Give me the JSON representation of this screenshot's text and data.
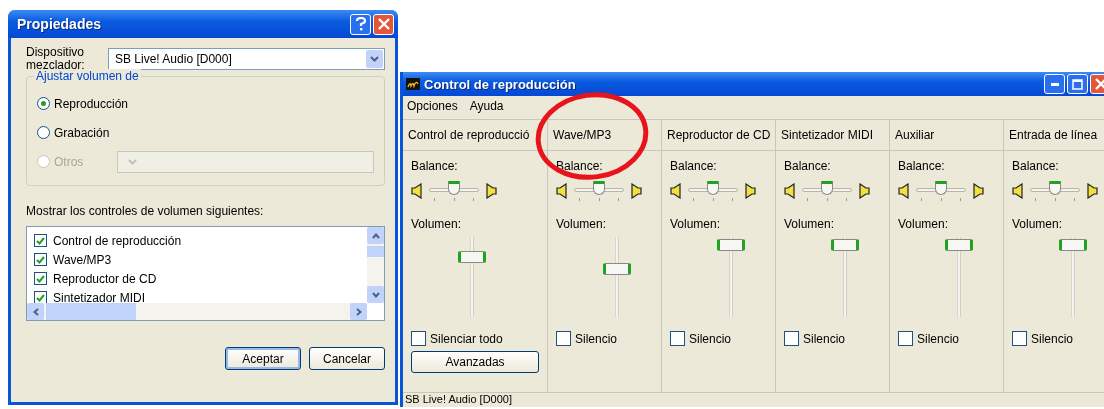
{
  "properties_dialog": {
    "title": "Propiedades",
    "mixer_label": "Dispositivo mezclador:",
    "mixer_value": "SB Live! Audio [D000]",
    "group_title": "Ajustar volumen de",
    "radios": [
      {
        "label": "Reproducción",
        "selected": true,
        "disabled": false
      },
      {
        "label": "Grabación",
        "selected": false,
        "disabled": false
      },
      {
        "label": "Otros",
        "selected": false,
        "disabled": true
      }
    ],
    "others_select": {
      "disabled": true
    },
    "list_label": "Mostrar los controles de volumen siguientes:",
    "list_items": [
      {
        "label": "Control de reproducción",
        "checked": true
      },
      {
        "label": "Wave/MP3",
        "checked": true
      },
      {
        "label": "Reproductor de CD",
        "checked": true
      },
      {
        "label": "Sintetizador MIDI",
        "checked": true
      }
    ],
    "buttons": [
      {
        "label": "Aceptar",
        "default": true
      },
      {
        "label": "Cancelar",
        "default": false
      }
    ]
  },
  "mixer_window": {
    "title": "Control de reproducción",
    "menu": [
      "Opciones",
      "Ayuda"
    ],
    "channels": [
      {
        "name": "Control de reproducció",
        "balance_label": "Balance:",
        "balance": {
          "level": 0.5
        },
        "volume_label": "Volumen:",
        "volume": {
          "level": 0.78
        },
        "mute_label": "Silenciar todo",
        "muted": false,
        "advanced": "Avanzadas"
      },
      {
        "name": "Wave/MP3",
        "balance_label": "Balance:",
        "balance": {
          "level": 0.5
        },
        "volume_label": "Volumen:",
        "volume": {
          "level": 0.6
        },
        "mute_label": "Silencio",
        "muted": false
      },
      {
        "name": "Reproductor de CD",
        "balance_label": "Balance:",
        "balance": {
          "level": 0.5
        },
        "volume_label": "Volumen:",
        "volume": {
          "level": 0.97
        },
        "mute_label": "Silencio",
        "muted": false
      },
      {
        "name": "Sintetizador MIDI",
        "balance_label": "Balance:",
        "balance": {
          "level": 0.5
        },
        "volume_label": "Volumen:",
        "volume": {
          "level": 0.97
        },
        "mute_label": "Silencio",
        "muted": false
      },
      {
        "name": "Auxiliar",
        "balance_label": "Balance:",
        "balance": {
          "level": 0.5
        },
        "volume_label": "Volumen:",
        "volume": {
          "level": 0.97
        },
        "mute_label": "Silencio",
        "muted": false
      },
      {
        "name": "Entrada de línea",
        "balance_label": "Balance:",
        "balance": {
          "level": 0.5
        },
        "volume_label": "Volumen:",
        "volume": {
          "level": 0.97
        },
        "mute_label": "Silencio",
        "muted": false
      }
    ],
    "status_bar": "SB Live! Audio [D000]"
  }
}
